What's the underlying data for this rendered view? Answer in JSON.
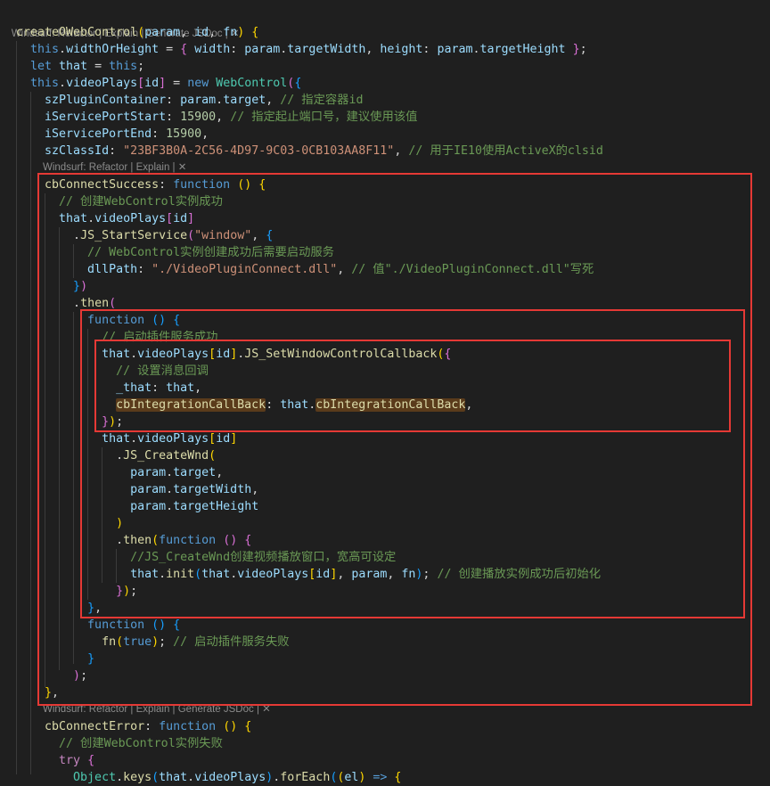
{
  "editor": {
    "language": "javascript",
    "lens": {
      "items": [
        "Windsurf: Refactor",
        "Explain",
        "Generate JSDoc"
      ],
      "separator": " | ",
      "close": "✕",
      "explain_only": [
        "Windsurf: Refactor",
        "Explain"
      ]
    },
    "lines": [
      {
        "segs": [
          [
            "createOWebControl",
            "fn"
          ],
          [
            "(",
            "br1"
          ],
          [
            "param",
            "var"
          ],
          [
            ", ",
            "pun"
          ],
          [
            "id",
            "var"
          ],
          [
            ", ",
            "pun"
          ],
          [
            "fn",
            "var"
          ],
          [
            ")",
            "br1"
          ],
          [
            " ",
            "pun"
          ],
          [
            "{",
            "br1"
          ]
        ]
      },
      {
        "segs": [
          [
            "  this",
            "kw"
          ],
          [
            ".",
            "pun"
          ],
          [
            "widthOrHeight",
            "prop"
          ],
          [
            " = ",
            "pun"
          ],
          [
            "{",
            "br2"
          ],
          [
            " ",
            "pun"
          ],
          [
            "width",
            "prop"
          ],
          [
            ": ",
            "pun"
          ],
          [
            "param",
            "var"
          ],
          [
            ".",
            "pun"
          ],
          [
            "targetWidth",
            "prop"
          ],
          [
            ", ",
            "pun"
          ],
          [
            "height",
            "prop"
          ],
          [
            ": ",
            "pun"
          ],
          [
            "param",
            "var"
          ],
          [
            ".",
            "pun"
          ],
          [
            "targetHeight",
            "prop"
          ],
          [
            " ",
            "pun"
          ],
          [
            "}",
            "br2"
          ],
          [
            ";",
            "pun"
          ]
        ]
      },
      {
        "segs": [
          [
            "  let ",
            "kw"
          ],
          [
            "that",
            "var"
          ],
          [
            " = ",
            "pun"
          ],
          [
            "this",
            "kw"
          ],
          [
            ";",
            "pun"
          ]
        ]
      },
      {
        "segs": [
          [
            "  this",
            "kw"
          ],
          [
            ".",
            "pun"
          ],
          [
            "videoPlays",
            "prop"
          ],
          [
            "[",
            "br2"
          ],
          [
            "id",
            "var"
          ],
          [
            "]",
            "br2"
          ],
          [
            " = ",
            "pun"
          ],
          [
            "new ",
            "kw"
          ],
          [
            "WebControl",
            "cls"
          ],
          [
            "(",
            "br2"
          ],
          [
            "{",
            "br3"
          ]
        ]
      },
      {
        "segs": [
          [
            "    szPluginContainer",
            "prop"
          ],
          [
            ": ",
            "pun"
          ],
          [
            "param",
            "var"
          ],
          [
            ".",
            "pun"
          ],
          [
            "target",
            "prop"
          ],
          [
            ", ",
            "pun"
          ],
          [
            "// 指定容器id",
            "com"
          ]
        ]
      },
      {
        "segs": [
          [
            "    iServicePortStart",
            "prop"
          ],
          [
            ": ",
            "pun"
          ],
          [
            "15900",
            "num"
          ],
          [
            ", ",
            "pun"
          ],
          [
            "// 指定起止端口号，建议使用该值",
            "com"
          ]
        ]
      },
      {
        "segs": [
          [
            "    iServicePortEnd",
            "prop"
          ],
          [
            ": ",
            "pun"
          ],
          [
            "15900",
            "num"
          ],
          [
            ",",
            "pun"
          ]
        ]
      },
      {
        "segs": [
          [
            "    szClassId",
            "prop"
          ],
          [
            ": ",
            "pun"
          ],
          [
            "\"23BF3B0A-2C56-4D97-9C03-0CB103AA8F11\"",
            "str"
          ],
          [
            ", ",
            "pun"
          ],
          [
            "// 用于IE10使用ActiveX的clsid",
            "com"
          ]
        ]
      },
      {
        "lens": "explain"
      },
      {
        "segs": [
          [
            "    cbConnectSuccess",
            "fn"
          ],
          [
            ": ",
            "pun"
          ],
          [
            "function ",
            "kw"
          ],
          [
            "()",
            "br1"
          ],
          [
            " ",
            "pun"
          ],
          [
            "{",
            "br1"
          ]
        ]
      },
      {
        "segs": [
          [
            "      // 创建WebControl实例成功",
            "com"
          ]
        ]
      },
      {
        "segs": [
          [
            "      that",
            "var"
          ],
          [
            ".",
            "pun"
          ],
          [
            "videoPlays",
            "prop"
          ],
          [
            "[",
            "br2"
          ],
          [
            "id",
            "var"
          ],
          [
            "]",
            "br2"
          ]
        ]
      },
      {
        "segs": [
          [
            "        .",
            "pun"
          ],
          [
            "JS_StartService",
            "fn"
          ],
          [
            "(",
            "br2"
          ],
          [
            "\"window\"",
            "str"
          ],
          [
            ", ",
            "pun"
          ],
          [
            "{",
            "br3"
          ]
        ]
      },
      {
        "segs": [
          [
            "          // WebControl实例创建成功后需要启动服务",
            "com"
          ]
        ]
      },
      {
        "segs": [
          [
            "          dllPath",
            "prop"
          ],
          [
            ": ",
            "pun"
          ],
          [
            "\"./VideoPluginConnect.dll\"",
            "str"
          ],
          [
            ", ",
            "pun"
          ],
          [
            "// 值\"./VideoPluginConnect.dll\"写死",
            "com"
          ]
        ]
      },
      {
        "segs": [
          [
            "        ",
            "pun"
          ],
          [
            "}",
            "br3"
          ],
          [
            ")",
            "br2"
          ]
        ]
      },
      {
        "segs": [
          [
            "        .",
            "pun"
          ],
          [
            "then",
            "fn"
          ],
          [
            "(",
            "br2"
          ]
        ]
      },
      {
        "segs": [
          [
            "          function ",
            "kw"
          ],
          [
            "()",
            "br3"
          ],
          [
            " ",
            "pun"
          ],
          [
            "{",
            "br3"
          ]
        ]
      },
      {
        "segs": [
          [
            "            // 启动插件服务成功",
            "com"
          ]
        ]
      },
      {
        "segs": [
          [
            "            that",
            "var"
          ],
          [
            ".",
            "pun"
          ],
          [
            "videoPlays",
            "prop"
          ],
          [
            "[",
            "br1"
          ],
          [
            "id",
            "var"
          ],
          [
            "]",
            "br1"
          ],
          [
            ".",
            "pun"
          ],
          [
            "JS_SetWindowControlCallback",
            "fn"
          ],
          [
            "(",
            "br1"
          ],
          [
            "{",
            "br2"
          ]
        ]
      },
      {
        "segs": [
          [
            "              // 设置消息回调",
            "com"
          ]
        ]
      },
      {
        "segs": [
          [
            "              _that",
            "prop"
          ],
          [
            ": ",
            "pun"
          ],
          [
            "that",
            "var"
          ],
          [
            ",",
            "pun"
          ]
        ]
      },
      {
        "segs": [
          [
            "              ",
            "pun"
          ],
          [
            "cbIntegrationCallBack",
            "fn",
            "sel"
          ],
          [
            ": ",
            "pun"
          ],
          [
            "that",
            "var"
          ],
          [
            ".",
            "pun"
          ],
          [
            "cbIntegrationCallBack",
            "fn",
            "sel"
          ],
          [
            ",",
            "pun"
          ]
        ]
      },
      {
        "segs": [
          [
            "            ",
            "pun"
          ],
          [
            "}",
            "br2"
          ],
          [
            ")",
            "br1"
          ],
          [
            ";",
            "pun"
          ]
        ]
      },
      {
        "segs": [
          [
            "            that",
            "var"
          ],
          [
            ".",
            "pun"
          ],
          [
            "videoPlays",
            "prop"
          ],
          [
            "[",
            "br1"
          ],
          [
            "id",
            "var"
          ],
          [
            "]",
            "br1"
          ]
        ]
      },
      {
        "segs": [
          [
            "              .",
            "pun"
          ],
          [
            "JS_CreateWnd",
            "fn"
          ],
          [
            "(",
            "br1"
          ]
        ]
      },
      {
        "segs": [
          [
            "                param",
            "var"
          ],
          [
            ".",
            "pun"
          ],
          [
            "target",
            "prop"
          ],
          [
            ",",
            "pun"
          ]
        ]
      },
      {
        "segs": [
          [
            "                param",
            "var"
          ],
          [
            ".",
            "pun"
          ],
          [
            "targetWidth",
            "prop"
          ],
          [
            ",",
            "pun"
          ]
        ]
      },
      {
        "segs": [
          [
            "                param",
            "var"
          ],
          [
            ".",
            "pun"
          ],
          [
            "targetHeight",
            "prop"
          ]
        ]
      },
      {
        "segs": [
          [
            "              ",
            "pun"
          ],
          [
            ")",
            "br1"
          ]
        ]
      },
      {
        "segs": [
          [
            "              .",
            "pun"
          ],
          [
            "then",
            "fn"
          ],
          [
            "(",
            "br1"
          ],
          [
            "function ",
            "kw"
          ],
          [
            "()",
            "br2"
          ],
          [
            " ",
            "pun"
          ],
          [
            "{",
            "br2"
          ]
        ]
      },
      {
        "segs": [
          [
            "                //JS_CreateWnd创建视频播放窗口，宽高可设定",
            "com"
          ]
        ]
      },
      {
        "segs": [
          [
            "                that",
            "var"
          ],
          [
            ".",
            "pun"
          ],
          [
            "init",
            "fn"
          ],
          [
            "(",
            "br3"
          ],
          [
            "that",
            "var"
          ],
          [
            ".",
            "pun"
          ],
          [
            "videoPlays",
            "prop"
          ],
          [
            "[",
            "br1"
          ],
          [
            "id",
            "var"
          ],
          [
            "]",
            "br1"
          ],
          [
            ", ",
            "pun"
          ],
          [
            "param",
            "var"
          ],
          [
            ", ",
            "pun"
          ],
          [
            "fn",
            "var"
          ],
          [
            ")",
            "br3"
          ],
          [
            "; ",
            "pun"
          ],
          [
            "// 创建播放实例成功后初始化",
            "com"
          ]
        ]
      },
      {
        "segs": [
          [
            "              ",
            "pun"
          ],
          [
            "}",
            "br2"
          ],
          [
            ")",
            "br1"
          ],
          [
            ";",
            "pun"
          ]
        ]
      },
      {
        "segs": [
          [
            "          ",
            "pun"
          ],
          [
            "}",
            "br3"
          ],
          [
            ",",
            "pun"
          ]
        ]
      },
      {
        "segs": [
          [
            "          function ",
            "kw"
          ],
          [
            "()",
            "br3"
          ],
          [
            " ",
            "pun"
          ],
          [
            "{",
            "br3"
          ]
        ]
      },
      {
        "segs": [
          [
            "            fn",
            "fn"
          ],
          [
            "(",
            "br1"
          ],
          [
            "true",
            "kw"
          ],
          [
            ")",
            "br1"
          ],
          [
            "; ",
            "pun"
          ],
          [
            "// 启动插件服务失败",
            "com"
          ]
        ]
      },
      {
        "segs": [
          [
            "          ",
            "pun"
          ],
          [
            "}",
            "br3"
          ]
        ]
      },
      {
        "segs": [
          [
            "        ",
            "pun"
          ],
          [
            ")",
            "br2"
          ],
          [
            ";",
            "pun"
          ]
        ]
      },
      {
        "segs": [
          [
            "    ",
            "pun"
          ],
          [
            "}",
            "br1"
          ],
          [
            ",",
            "pun"
          ]
        ]
      },
      {
        "lens": "full"
      },
      {
        "segs": [
          [
            "    cbConnectError",
            "fn"
          ],
          [
            ": ",
            "pun"
          ],
          [
            "function ",
            "kw"
          ],
          [
            "()",
            "br1"
          ],
          [
            " ",
            "pun"
          ],
          [
            "{",
            "br1"
          ]
        ]
      },
      {
        "segs": [
          [
            "      // 创建WebControl实例失败",
            "com"
          ]
        ]
      },
      {
        "segs": [
          [
            "      try ",
            "ctl"
          ],
          [
            "{",
            "br2"
          ]
        ]
      },
      {
        "segs": [
          [
            "        Object",
            "cls"
          ],
          [
            ".",
            "pun"
          ],
          [
            "keys",
            "fn"
          ],
          [
            "(",
            "br3"
          ],
          [
            "that",
            "var"
          ],
          [
            ".",
            "pun"
          ],
          [
            "videoPlays",
            "prop"
          ],
          [
            ")",
            "br3"
          ],
          [
            ".",
            "pun"
          ],
          [
            "forEach",
            "fn"
          ],
          [
            "(",
            "br3"
          ],
          [
            "(",
            "br1"
          ],
          [
            "el",
            "var"
          ],
          [
            ")",
            "br1"
          ],
          [
            " => ",
            "kw"
          ],
          [
            "{",
            "br1"
          ]
        ]
      }
    ]
  }
}
